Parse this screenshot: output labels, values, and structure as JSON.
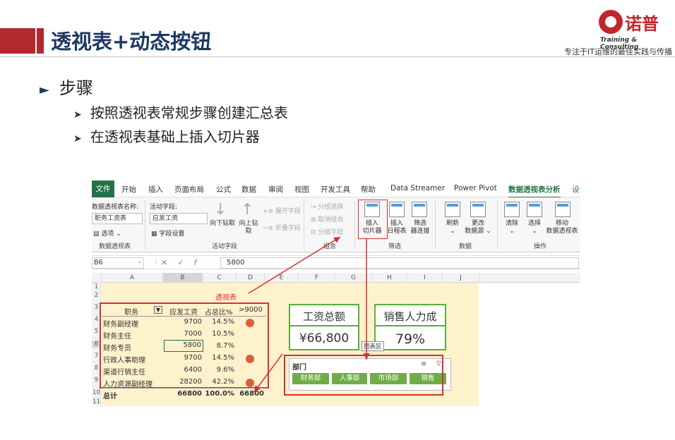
{
  "slide": {
    "title": "透视表+动态按钮",
    "logo_zh": "诺普",
    "logo_en": "Training & Consulting",
    "tagline": "专注于IT运维的最佳实践与传播",
    "bullet_main": "步骤",
    "bullets": [
      "按照透视表常规步骤创建汇总表",
      "在透视表基础上插入切片器"
    ]
  },
  "excel": {
    "menu": [
      "文件",
      "开始",
      "插入",
      "页面布局",
      "公式",
      "数据",
      "审阅",
      "视图",
      "开发工具",
      "帮助",
      "Data Streamer",
      "Power Pivot",
      "数据透视表分析",
      "设计"
    ],
    "ribbon": {
      "pivot_name_label": "数据透视表名称:",
      "pivot_name_value": "职务工资表",
      "options_label": "选项",
      "group_pivot": "数据透视表",
      "active_field_label": "活动字段:",
      "active_field_value": "应发工资",
      "field_settings": "字段设置",
      "drill_down": "向下钻取",
      "drill_up": "向上钻",
      "drill_up2": "取",
      "expand_field": "展开字段",
      "collapse_field": "折叠字段",
      "group_active": "活动字段",
      "group_selection": "分组选择",
      "ungroup": "取消组合",
      "group_field": "分组字段",
      "group_group": "组合",
      "insert_slicer_1": "插入",
      "insert_slicer_2": "切片器",
      "insert_timeline_1": "插入",
      "insert_timeline_2": "日程表",
      "filter_conn_1": "筛选",
      "filter_conn_2": "器连接",
      "group_filter": "筛选",
      "refresh": "刷新",
      "change_source_1": "更改",
      "change_source_2": "数据源",
      "group_data": "数据",
      "clear": "清除",
      "select": "选择",
      "move_1": "移动",
      "move_2": "数据透视表",
      "group_actions": "操作"
    },
    "formula": {
      "name_box": "B6",
      "value": "5800"
    },
    "columns": [
      "A",
      "B",
      "C",
      "D",
      "E",
      "F",
      "G",
      "H",
      "I",
      "J"
    ],
    "rows": [
      "1",
      "2",
      "3",
      "4",
      "5",
      "6",
      "7",
      "8",
      "9",
      "10",
      "11"
    ],
    "pivot": {
      "caption": "透视表",
      "headers": [
        "职务",
        "应发工资",
        "占总比%",
        ">9000"
      ],
      "data": [
        {
          "role": "财务副经理",
          "salary": "9700",
          "pct": "14.5%",
          "flag": true
        },
        {
          "role": "财务主任",
          "salary": "7000",
          "pct": "10.5%",
          "flag": false
        },
        {
          "role": "财务专员",
          "salary": "5800",
          "pct": "8.7%",
          "flag": false
        },
        {
          "role": "行政人事助理",
          "salary": "9700",
          "pct": "14.5%",
          "flag": true
        },
        {
          "role": "渠道行销主任",
          "salary": "6400",
          "pct": "9.6%",
          "flag": false
        },
        {
          "role": "人力资源副经理",
          "salary": "28200",
          "pct": "42.2%",
          "flag": true
        }
      ],
      "total": {
        "label": "总计",
        "salary": "66800",
        "pct": "100.0%",
        "over": "66800"
      }
    },
    "cards": {
      "total_salary_label": "工资总额",
      "total_salary_value": "¥66,800",
      "sales_label": "销售人力成",
      "sales_value": "79%"
    },
    "tooltip": "图表区",
    "slicer": {
      "title": "部门",
      "buttons": [
        "财务部",
        "人事部",
        "市场部",
        "销售"
      ]
    }
  }
}
